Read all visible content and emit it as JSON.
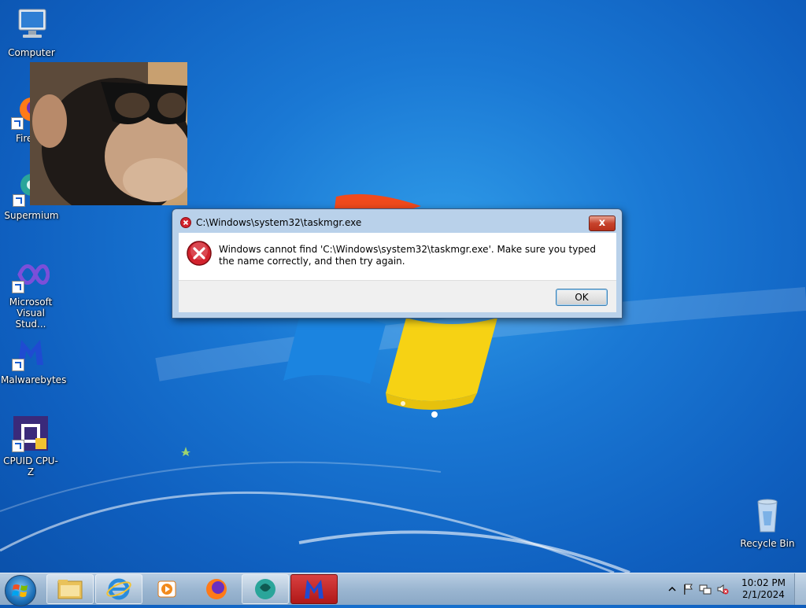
{
  "desktop": {
    "icons": [
      {
        "label": "Computer",
        "icon": "computer-icon"
      },
      {
        "label": "Fire",
        "icon": "firefox-icon"
      },
      {
        "label": "Supermium",
        "icon": "supermium-icon"
      },
      {
        "label": "Microsoft Visual Stud...",
        "icon": "visual-studio-icon"
      },
      {
        "label": "Malwarebytes",
        "icon": "malwarebytes-icon"
      },
      {
        "label": "CPUID CPU-Z",
        "icon": "cpuz-icon"
      },
      {
        "label": "Recycle Bin",
        "icon": "recycle-bin-icon"
      }
    ]
  },
  "dialog": {
    "title": "C:\\Windows\\system32\\taskmgr.exe",
    "message": "Windows cannot find 'C:\\Windows\\system32\\taskmgr.exe'. Make sure you typed the name correctly, and then try again.",
    "ok_label": "OK",
    "close_label": "x"
  },
  "taskbar": {
    "apps": [
      {
        "name": "file-explorer"
      },
      {
        "name": "internet-explorer"
      },
      {
        "name": "media-player"
      },
      {
        "name": "firefox"
      },
      {
        "name": "supermium"
      },
      {
        "name": "malwarebytes"
      }
    ],
    "clock": {
      "time": "10:02 PM",
      "date": "2/1/2024"
    }
  },
  "colors": {
    "accent": "#1a78d4",
    "error": "#c7432c",
    "taskbar": "#9bb6d1"
  }
}
